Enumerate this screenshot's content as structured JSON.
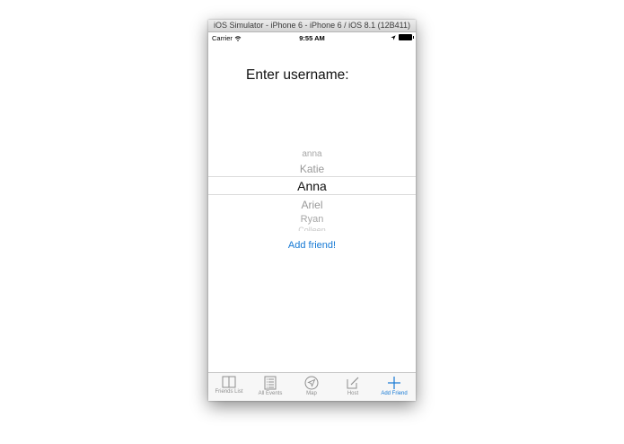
{
  "window": {
    "title": "iOS Simulator - iPhone 6 - iPhone 6 / iOS 8.1 (12B411)"
  },
  "statusbar": {
    "carrier": "Carrier",
    "time": "9:55 AM"
  },
  "prompt": "Enter username:",
  "picker": {
    "items": [
      "anna",
      "Katie",
      "Anna",
      "Ariel",
      "Ryan",
      "Colleen"
    ],
    "selected": "Anna"
  },
  "add_friend_label": "Add friend!",
  "tabs": [
    {
      "label": "Friends List",
      "icon": "book-icon"
    },
    {
      "label": "All Events",
      "icon": "list-icon"
    },
    {
      "label": "Map",
      "icon": "compass-icon"
    },
    {
      "label": "Host",
      "icon": "compose-icon"
    },
    {
      "label": "Add Friend",
      "icon": "plus-icon",
      "active": true
    }
  ],
  "colors": {
    "accent": "#1478d4",
    "tab_inactive": "#8e8e8e"
  }
}
